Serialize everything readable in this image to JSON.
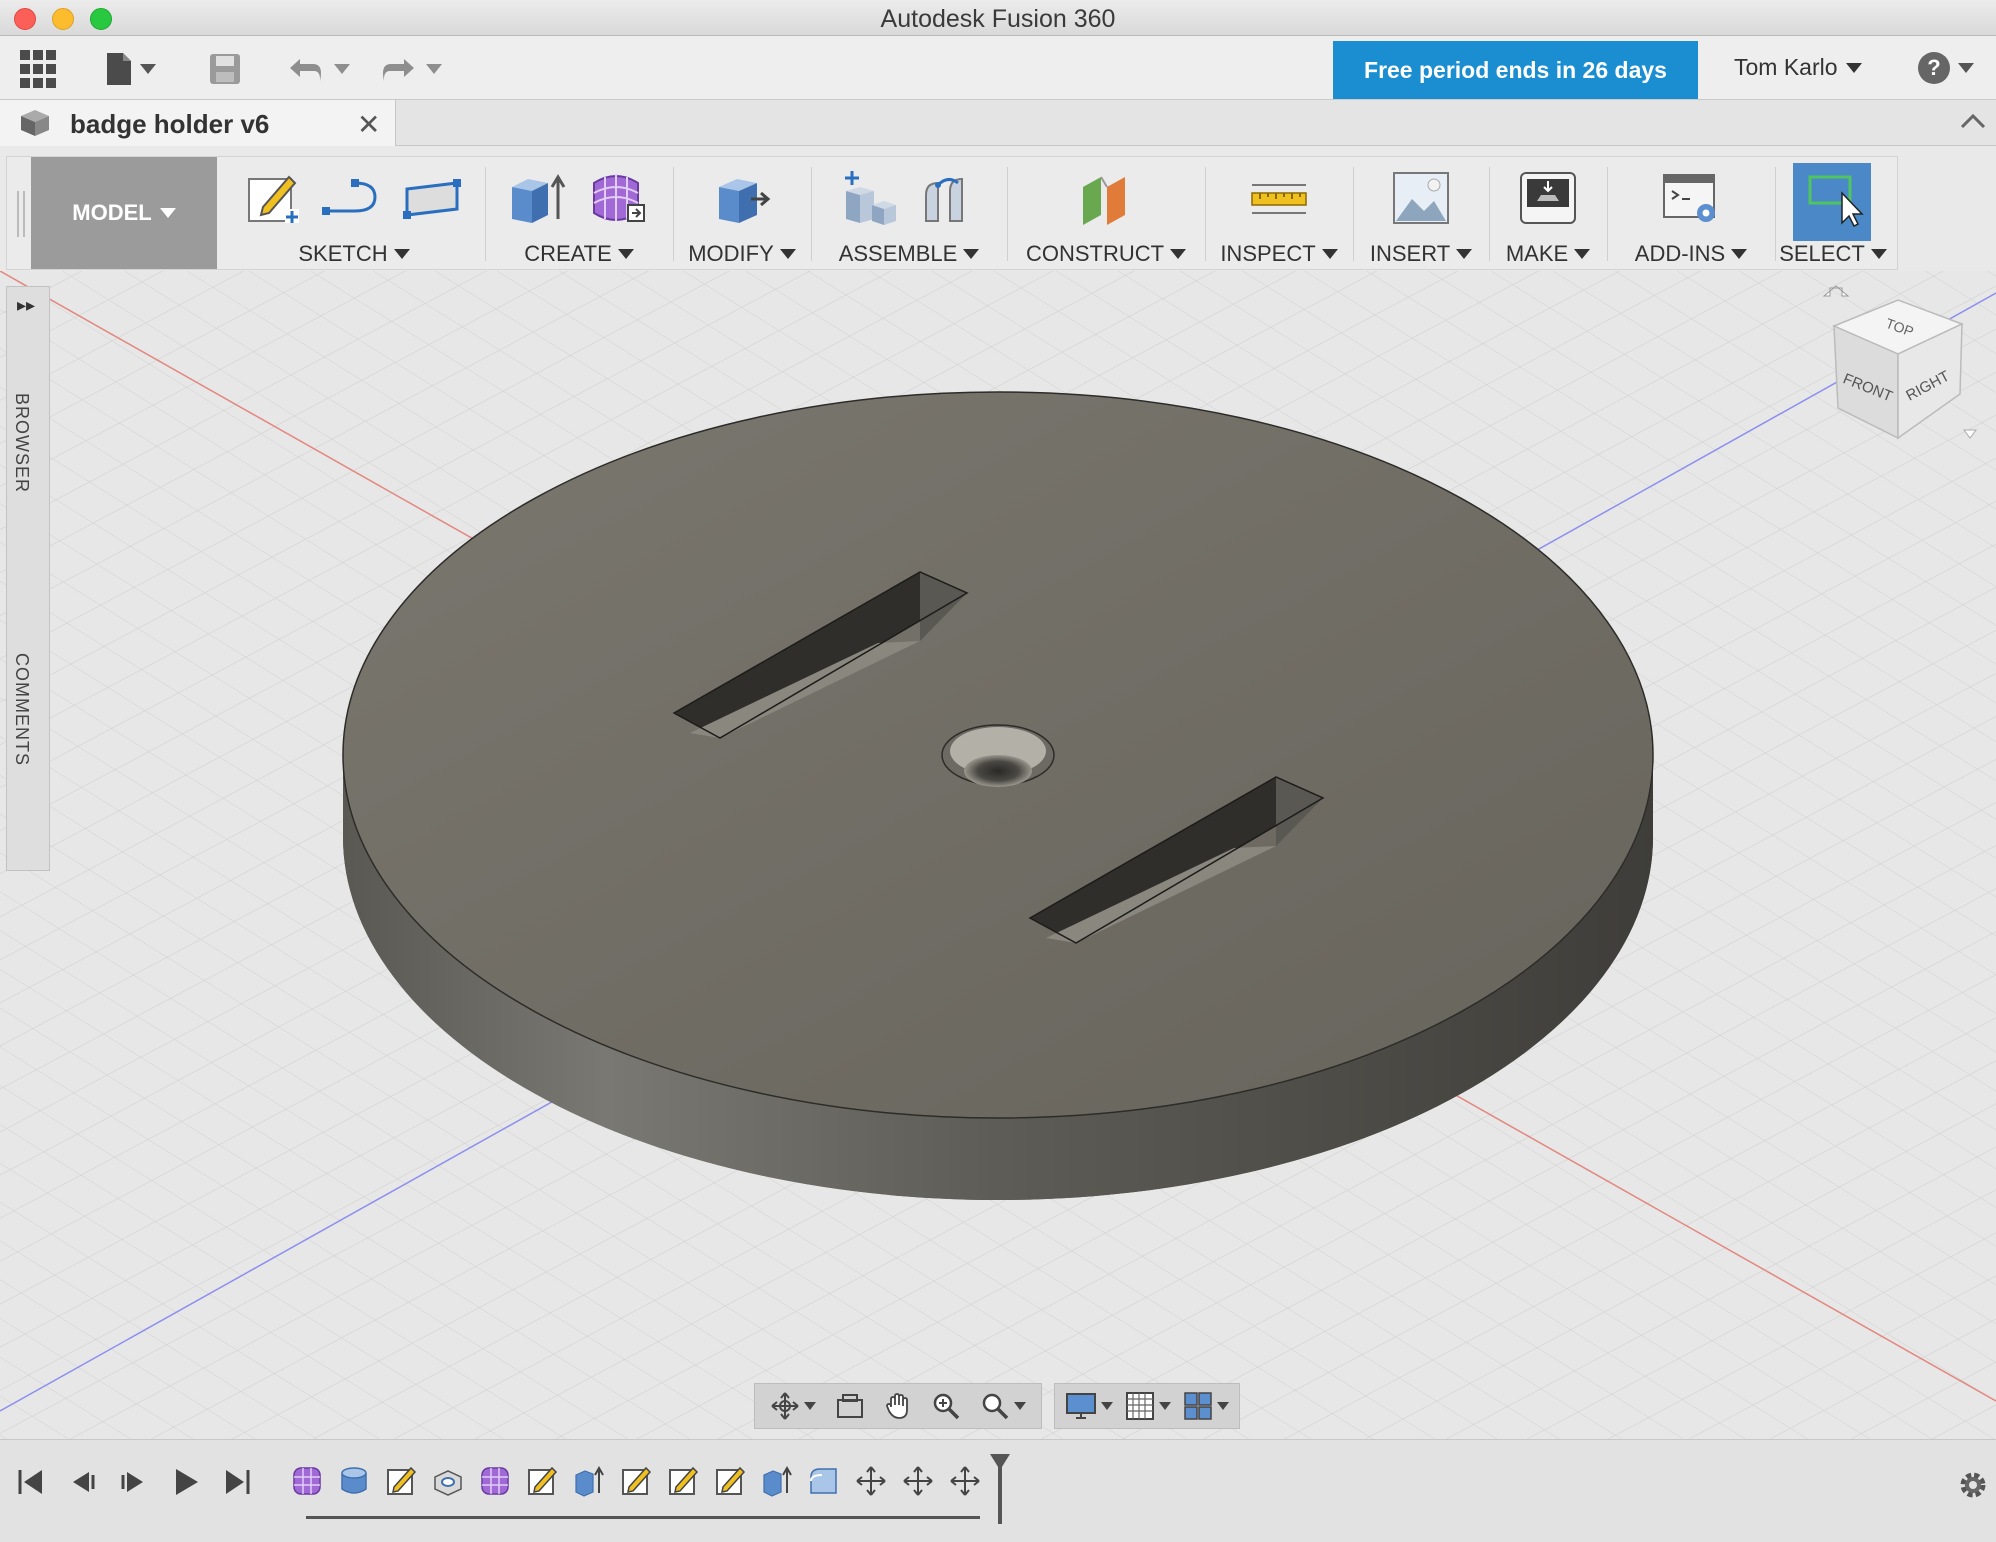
{
  "window": {
    "title": "Autodesk Fusion 360"
  },
  "toolbar": {
    "trial_banner": "Free period ends in 26 days",
    "user_name": "Tom Karlo",
    "help_label": "?"
  },
  "document_tab": {
    "label": "badge holder v6",
    "close": "✕"
  },
  "ribbon": {
    "workspace": "MODEL",
    "groups": [
      {
        "label": "SKETCH"
      },
      {
        "label": "CREATE"
      },
      {
        "label": "MODIFY"
      },
      {
        "label": "ASSEMBLE"
      },
      {
        "label": "CONSTRUCT"
      },
      {
        "label": "INSPECT"
      },
      {
        "label": "INSERT"
      },
      {
        "label": "MAKE"
      },
      {
        "label": "ADD-INS"
      },
      {
        "label": "SELECT"
      }
    ]
  },
  "side_panel": {
    "browser": "BROWSER",
    "comments": "COMMENTS",
    "expand": "▸▸"
  },
  "viewcube": {
    "top": "TOP",
    "front": "FRONT",
    "right": "RIGHT"
  },
  "colors": {
    "accent": "#1b8ed1",
    "select_highlight": "#4a88c7",
    "model_body": "#6f6c63"
  }
}
